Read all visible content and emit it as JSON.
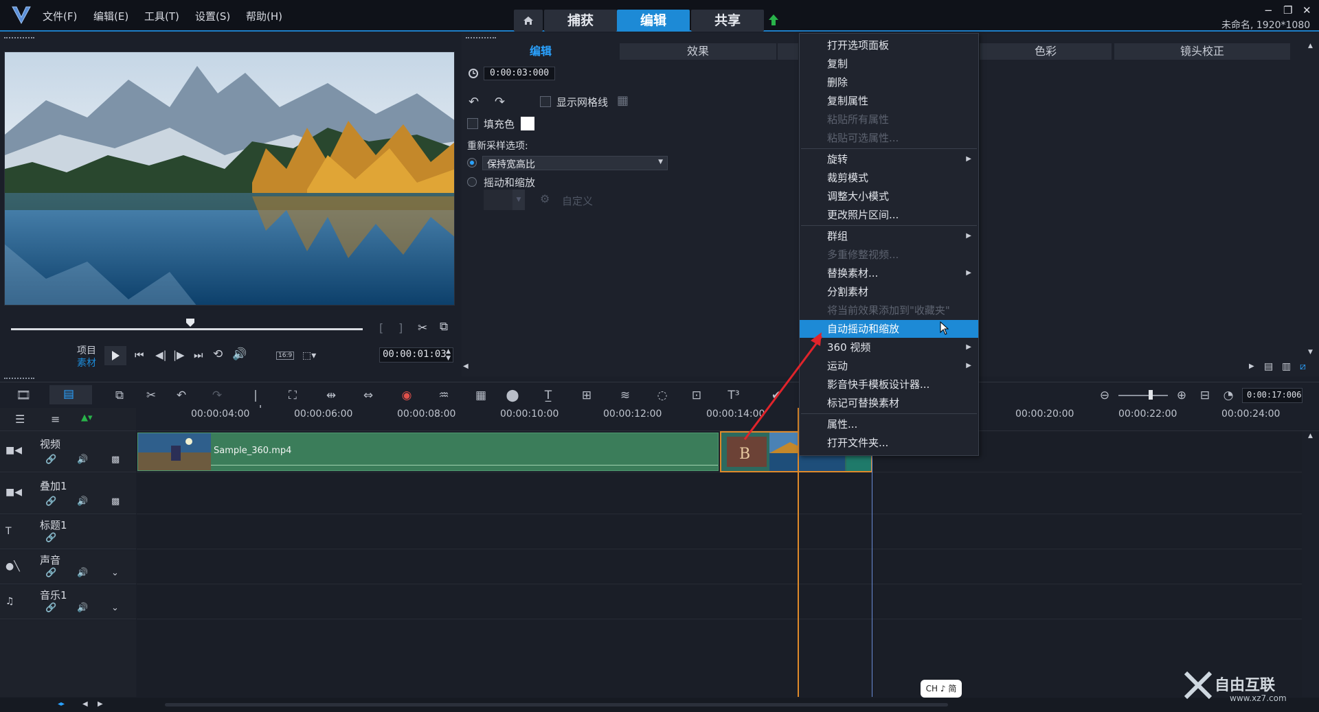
{
  "menubar": {
    "items": [
      "文件(F)",
      "编辑(E)",
      "工具(T)",
      "设置(S)",
      "帮助(H)"
    ]
  },
  "modes": {
    "home_icon": "home-icon",
    "capture": "捕获",
    "edit": "编辑",
    "share": "共享",
    "upload_icon": "upload-icon"
  },
  "window": {
    "minimize": "−",
    "restore": "❐",
    "close": "✕",
    "project_info": "未命名, 1920*1080"
  },
  "player": {
    "project_label": "项目",
    "clip_label": "素材",
    "timecode": "00:00:01:03",
    "position_fraction": 0.51,
    "aspect_label": "16:9"
  },
  "options_panel": {
    "tabs": [
      "编辑",
      "效果",
      "色彩",
      "镜头校正"
    ],
    "duration": "0:00:03:000",
    "show_grid": "显示网格线",
    "fill_color": "填充色",
    "resample_heading": "重新采样选项:",
    "keep_aspect": "保持宽高比",
    "pan_zoom": "摇动和缩放",
    "custom": "自定义"
  },
  "context_menu": {
    "items": [
      {
        "label": "打开选项面板",
        "state": "normal"
      },
      {
        "label": "复制",
        "state": "normal"
      },
      {
        "label": "删除",
        "state": "normal"
      },
      {
        "label": "复制属性",
        "state": "normal"
      },
      {
        "label": "粘贴所有属性",
        "state": "disabled"
      },
      {
        "label": "粘贴可选属性...",
        "state": "disabled"
      },
      {
        "label": "旋转",
        "state": "submenu"
      },
      {
        "label": "裁剪模式",
        "state": "normal"
      },
      {
        "label": "调整大小模式",
        "state": "normal"
      },
      {
        "label": "更改照片区间...",
        "state": "normal"
      },
      {
        "label": "群组",
        "state": "submenu"
      },
      {
        "label": "多重修整视频...",
        "state": "disabled"
      },
      {
        "label": "替换素材...",
        "state": "submenu"
      },
      {
        "label": "分割素材",
        "state": "normal"
      },
      {
        "label": "将当前效果添加到\"收藏夹\"",
        "state": "disabled"
      },
      {
        "label": "自动摇动和缩放",
        "state": "highlighted"
      },
      {
        "label": "360 视频",
        "state": "submenu"
      },
      {
        "label": "运动",
        "state": "submenu"
      },
      {
        "label": "影音快手模板设计器...",
        "state": "normal"
      },
      {
        "label": "标记可替换素材",
        "state": "normal"
      },
      {
        "label": "属性...",
        "state": "normal"
      },
      {
        "label": "打开文件夹...",
        "state": "normal"
      }
    ]
  },
  "timeline": {
    "zoom_timecode": "0:00:17:006",
    "ruler": [
      "00:00:04:00",
      "00:00:06:00",
      "00:00:08:00",
      "00:00:10:00",
      "00:00:12:00",
      "00:00:14:00",
      "00:00:20:00",
      "00:00:22:00",
      "00:00:24:00"
    ],
    "tracks": [
      {
        "name": "视频",
        "icon": "video-track-icon"
      },
      {
        "name": "叠加1",
        "icon": "overlay-track-icon"
      },
      {
        "name": "标题1",
        "icon": "title-track-icon"
      },
      {
        "name": "声音",
        "icon": "voice-track-icon"
      },
      {
        "name": "音乐1",
        "icon": "music-track-icon"
      }
    ],
    "clip_name": "Sample_360.mp4"
  },
  "ime": {
    "label": "CH ♪ 简"
  },
  "watermark": {
    "text": "自由互联",
    "sub": "www.xz7.com"
  },
  "colors": {
    "accent": "#1d8ad6",
    "video_clip": "#3b7d5a",
    "playhead": "#e08a2a",
    "arrow": "#e0242b"
  }
}
